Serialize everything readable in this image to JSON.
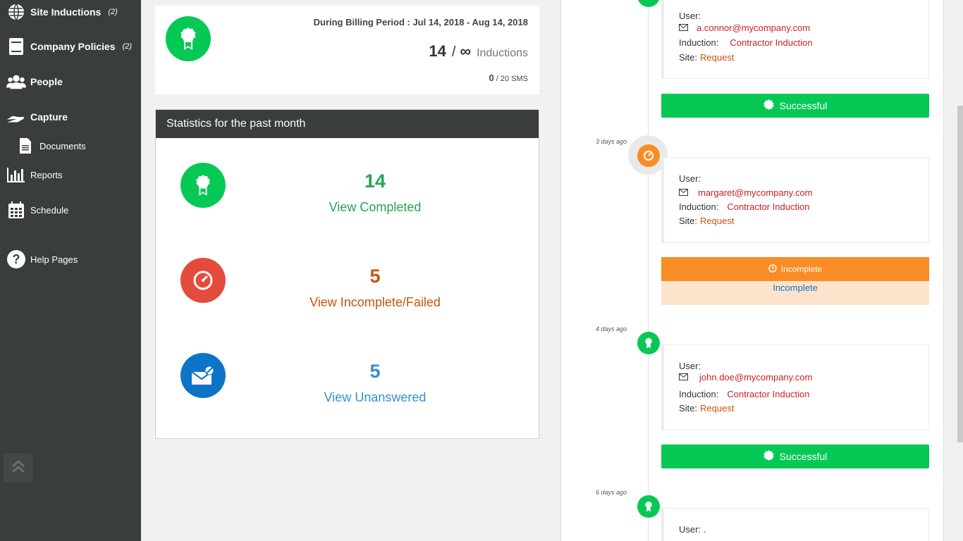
{
  "sidebar": {
    "items": [
      {
        "label": "Site Inductions",
        "count": "(2)",
        "icon": "globe-icon"
      },
      {
        "label": "Company Policies",
        "count": "(2)",
        "icon": "book-icon"
      },
      {
        "label": "People",
        "icon": "people-icon"
      },
      {
        "label": "Capture",
        "icon": "hand-icon"
      },
      {
        "label": "Documents",
        "icon": "document-icon"
      },
      {
        "label": "Reports",
        "icon": "bar-chart-icon"
      },
      {
        "label": "Schedule",
        "icon": "calendar-icon"
      },
      {
        "label": "Help Pages",
        "icon": "question-icon"
      }
    ]
  },
  "summary": {
    "billing_label": "During Billing Period : Jul 14, 2018 - Aug 14, 2018",
    "count": "14",
    "separator": "/",
    "limit": "∞",
    "unit": "Inductions",
    "sms_used": "0",
    "sms_total": "/ 20 SMS"
  },
  "stats": {
    "title": "Statistics for the past month",
    "completed": {
      "value": "14",
      "label": "View Completed",
      "color": "#27a35a"
    },
    "incomplete": {
      "value": "5",
      "label": "View Incomplete/Failed",
      "color": "#c8540e"
    },
    "unanswered": {
      "value": "5",
      "label": "View Unanswered",
      "color": "#3a8fd0"
    }
  },
  "timeline": {
    "entries": [
      {
        "ago": "",
        "user_label": "User:",
        "email": "a.connor@mycompany.com",
        "induction_label": "Induction:",
        "induction": "Contractor Induction",
        "site_label": "Site:",
        "site": "Request",
        "status": "Successful"
      },
      {
        "ago": "3 days ago",
        "user_label": "User:",
        "email": "margaret@mycompany.com",
        "induction_label": "Induction:",
        "induction": "Contractor Induction",
        "site_label": "Site:",
        "site": "Request",
        "status": "Incomplete",
        "status_detail": "Incomplete"
      },
      {
        "ago": "4 days ago",
        "user_label": "User:",
        "email": "john.doe@mycompany.com",
        "induction_label": "Induction:",
        "induction": "Contractor Induction",
        "site_label": "Site:",
        "site": "Request",
        "status": "Successful"
      },
      {
        "ago": "6 days ago",
        "user_label": "User:",
        "email": "."
      }
    ]
  },
  "colors": {
    "green": "#05c954",
    "orange": "#f98c25",
    "red": "#e54b3c",
    "blue": "#0d74c8",
    "sidebar": "#3a3d3e"
  }
}
